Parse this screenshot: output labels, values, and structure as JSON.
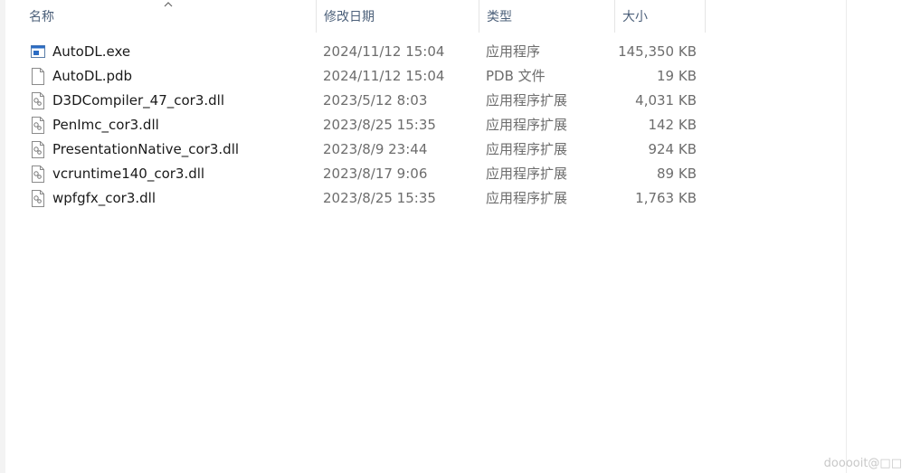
{
  "columns": {
    "name": "名称",
    "date": "修改日期",
    "type": "类型",
    "size": "大小"
  },
  "sort_indicator": "ascending",
  "files": [
    {
      "name": "AutoDL.exe",
      "date": "2024/11/12 15:04",
      "type": "应用程序",
      "size": "145,350 KB",
      "icon": "exe-icon"
    },
    {
      "name": "AutoDL.pdb",
      "date": "2024/11/12 15:04",
      "type": "PDB 文件",
      "size": "19 KB",
      "icon": "file-icon"
    },
    {
      "name": "D3DCompiler_47_cor3.dll",
      "date": "2023/5/12 8:03",
      "type": "应用程序扩展",
      "size": "4,031 KB",
      "icon": "dll-icon"
    },
    {
      "name": "PenImc_cor3.dll",
      "date": "2023/8/25 15:35",
      "type": "应用程序扩展",
      "size": "142 KB",
      "icon": "dll-icon"
    },
    {
      "name": "PresentationNative_cor3.dll",
      "date": "2023/8/9 23:44",
      "type": "应用程序扩展",
      "size": "924 KB",
      "icon": "dll-icon"
    },
    {
      "name": "vcruntime140_cor3.dll",
      "date": "2023/8/17 9:06",
      "type": "应用程序扩展",
      "size": "89 KB",
      "icon": "dll-icon"
    },
    {
      "name": "wpfgfx_cor3.dll",
      "date": "2023/8/25 15:35",
      "type": "应用程序扩展",
      "size": "1,763 KB",
      "icon": "dll-icon"
    }
  ],
  "watermark": "dooooit@□□"
}
